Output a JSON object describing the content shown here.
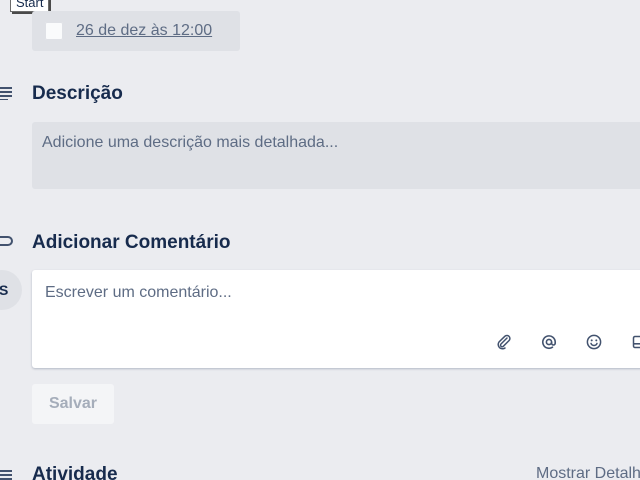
{
  "tooltip": {
    "text": "Start"
  },
  "due_date": {
    "text": "26 de dez às 12:00"
  },
  "description": {
    "title": "Descrição",
    "placeholder": "Adicione uma descrição mais detalhada..."
  },
  "comment": {
    "title": "Adicionar Comentário",
    "avatar_initial": "S",
    "placeholder": "Escrever um comentário...",
    "save_label": "Salvar"
  },
  "activity": {
    "title": "Atividade",
    "show_details": "Mostrar Detalhes"
  },
  "icons": {
    "description": "description-lines-icon",
    "comment": "comment-bubble-icon",
    "attachment": "paperclip-icon",
    "mention": "at-sign-icon",
    "emoji": "smiley-icon",
    "card": "card-icon",
    "activity": "activity-lines-icon"
  },
  "colors": {
    "background": "#ebecf0",
    "chip": "#dfe1e6",
    "text_primary": "#172b4d",
    "text_subtle": "#5e6c84",
    "button_disabled_text": "#a5adba"
  }
}
